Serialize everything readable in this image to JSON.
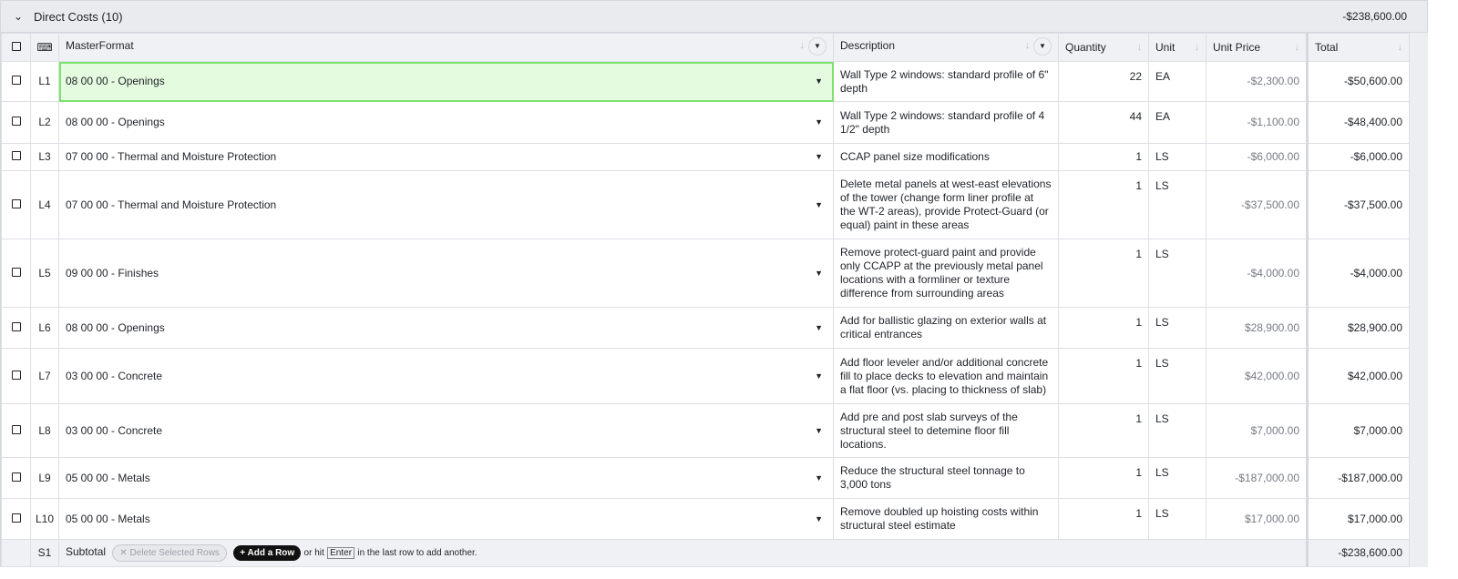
{
  "group": {
    "title": "Direct Costs (10)",
    "total": "-$238,600.00"
  },
  "columns": {
    "masterformat": "MasterFormat",
    "description": "Description",
    "quantity": "Quantity",
    "unit": "Unit",
    "unit_price": "Unit Price",
    "total": "Total"
  },
  "rows": [
    {
      "id": "L1",
      "mf": "08 00 00 - Openings",
      "desc": "Wall Type 2 windows: standard profile of 6\" depth",
      "qty": "22",
      "unit": "EA",
      "price": "-$2,300.00",
      "total": "-$50,600.00"
    },
    {
      "id": "L2",
      "mf": "08 00 00 - Openings",
      "desc": "Wall Type 2 windows: standard profile of 4 1/2\" depth",
      "qty": "44",
      "unit": "EA",
      "price": "-$1,100.00",
      "total": "-$48,400.00"
    },
    {
      "id": "L3",
      "mf": "07 00 00 - Thermal and Moisture Protection",
      "desc": "CCAP panel size modifications",
      "qty": "1",
      "unit": "LS",
      "price": "-$6,000.00",
      "total": "-$6,000.00"
    },
    {
      "id": "L4",
      "mf": "07 00 00 - Thermal and Moisture Protection",
      "desc": "Delete metal panels at west-east elevations of the tower (change form liner profile at the WT-2 areas), provide Protect-Guard (or equal) paint in these areas",
      "qty": "1",
      "unit": "LS",
      "price": "-$37,500.00",
      "total": "-$37,500.00"
    },
    {
      "id": "L5",
      "mf": "09 00 00 - Finishes",
      "desc": "Remove protect-guard paint and provide only CCAPP at the previously metal panel locations with a formliner or texture difference from surrounding areas",
      "qty": "1",
      "unit": "LS",
      "price": "-$4,000.00",
      "total": "-$4,000.00"
    },
    {
      "id": "L6",
      "mf": "08 00 00 - Openings",
      "desc": "Add for ballistic glazing on exterior walls at critical entrances",
      "qty": "1",
      "unit": "LS",
      "price": "$28,900.00",
      "total": "$28,900.00"
    },
    {
      "id": "L7",
      "mf": "03 00 00 - Concrete",
      "desc": "Add floor leveler and/or additional concrete fill to place decks to elevation and maintain a flat floor (vs. placing to thickness of slab)",
      "qty": "1",
      "unit": "LS",
      "price": "$42,000.00",
      "total": "$42,000.00"
    },
    {
      "id": "L8",
      "mf": "03 00 00 - Concrete",
      "desc": "Add pre and post slab surveys of the structural steel to detemine floor fill locations.",
      "qty": "1",
      "unit": "LS",
      "price": "$7,000.00",
      "total": "$7,000.00"
    },
    {
      "id": "L9",
      "mf": "05 00 00 - Metals",
      "desc": "Reduce the structural steel tonnage to 3,000 tons",
      "qty": "1",
      "unit": "LS",
      "price": "-$187,000.00",
      "total": "-$187,000.00"
    },
    {
      "id": "L10",
      "mf": "05 00 00 - Metals",
      "desc": "Remove doubled up hoisting costs within structural steel estimate",
      "qty": "1",
      "unit": "LS",
      "price": "$17,000.00",
      "total": "$17,000.00"
    }
  ],
  "subtotal": {
    "id": "S1",
    "label": "Subtotal",
    "delete_label": "✕ Delete Selected Rows",
    "add_label": "+ Add a Row",
    "hint_pre": "or hit",
    "key": "Enter",
    "hint_post": "in the last row to add another.",
    "total": "-$238,600.00"
  }
}
